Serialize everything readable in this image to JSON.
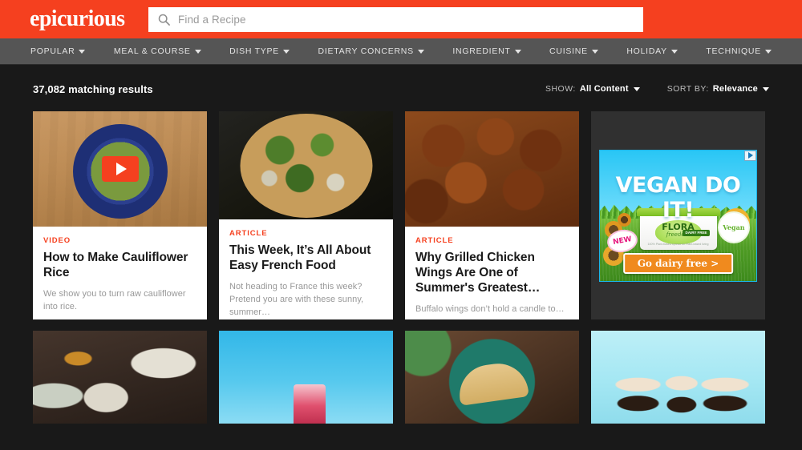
{
  "brand": {
    "logo_text": "epicurious",
    "accent_color": "#f5401f",
    "nav_bg": "#555555",
    "page_bg": "#191919"
  },
  "search": {
    "placeholder": "Find a Recipe",
    "value": "",
    "icon": "search-icon"
  },
  "nav": {
    "items": [
      {
        "label": "POPULAR",
        "icon": "chevron-down-icon"
      },
      {
        "label": "MEAL & COURSE",
        "icon": "chevron-down-icon"
      },
      {
        "label": "DISH TYPE",
        "icon": "chevron-down-icon"
      },
      {
        "label": "DIETARY CONCERNS",
        "icon": "chevron-down-icon"
      },
      {
        "label": "INGREDIENT",
        "icon": "chevron-down-icon"
      },
      {
        "label": "CUISINE",
        "icon": "chevron-down-icon"
      },
      {
        "label": "HOLIDAY",
        "icon": "chevron-down-icon"
      },
      {
        "label": "TECHNIQUE",
        "icon": "chevron-down-icon"
      }
    ]
  },
  "results": {
    "count_text": "37,082 matching results",
    "show": {
      "label": "SHOW:",
      "value": "All Content",
      "icon": "chevron-down-icon"
    },
    "sort": {
      "label": "SORT BY:",
      "value": "Relevance",
      "icon": "chevron-down-icon"
    }
  },
  "cards": [
    {
      "kicker": "VIDEO",
      "title": "How to Make Cauliflower Rice",
      "dek": "We show you to turn raw cauliflower into rice.",
      "has_play_button": true,
      "image": "cauliflower-rice-in-blue-bowl-on-wood"
    },
    {
      "kicker": "ARTICLE",
      "title": "This Week, It’s All About Easy French Food",
      "dek": "Not heading to France this week? Pretend you are with these sunny, summer…",
      "has_play_button": false,
      "image": "herb-topped-pizza-on-dark-surface"
    },
    {
      "kicker": "ARTICLE",
      "title": "Why Grilled Chicken Wings Are One of Summer's Greatest…",
      "dek": "Buffalo wings don’t hold a candle to…",
      "has_play_button": false,
      "image": "pile-of-grilled-chicken-wings"
    }
  ],
  "ad": {
    "adchoices_icon": "adchoices-icon",
    "headline": "VEGAN DO IT!",
    "brand": "FLORA",
    "brand_sub": "freedom",
    "brand_badge": "DAIRY FREE",
    "fine_print": "100% Plant-based spread for Plant-based living",
    "new_badge": "NEW",
    "vegan_badge": "Vegan",
    "cta": "Go dairy free >"
  },
  "row2": [
    {
      "image": "table-set-with-stew-bowls-and-pot"
    },
    {
      "image": "hand-pouring-wine-into-iced-cocktail"
    },
    {
      "image": "three-tacos-on-green-plate"
    },
    {
      "image": "three-root-beer-float-glasses"
    }
  ]
}
